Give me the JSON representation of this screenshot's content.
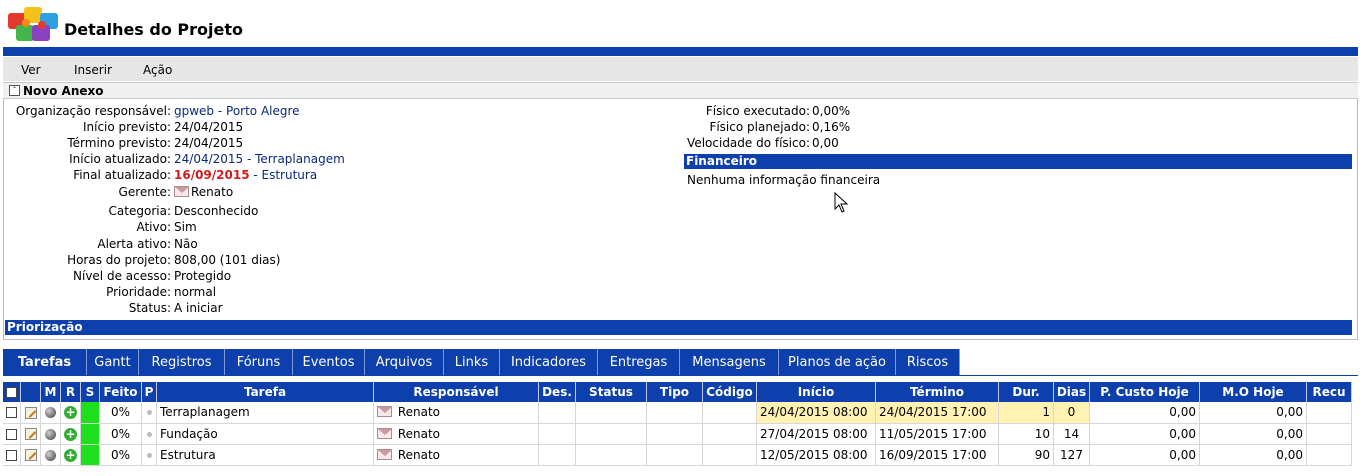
{
  "header": {
    "title": "Detalhes do Projeto"
  },
  "menu": {
    "items": [
      "Ver",
      "Inserir",
      "Ação"
    ]
  },
  "section": {
    "title": "Novo Anexo"
  },
  "details": {
    "organizacao_label": "Organização responsável:",
    "organizacao_value": "gpweb - Porto Alegre",
    "inicio_previsto_label": "Início previsto:",
    "inicio_previsto_value": "24/04/2015",
    "termino_previsto_label": "Término previsto:",
    "termino_previsto_value": "24/04/2015",
    "inicio_atualizado_label": "Início atualizado:",
    "inicio_atualizado_value": "24/04/2015 - Terraplanagem",
    "final_atualizado_label": "Final atualizado:",
    "final_atualizado_date": "16/09/2015",
    "final_atualizado_task": " - Estrutura",
    "gerente_label": "Gerente:",
    "gerente_value": "Renato",
    "categoria_label": "Categoria:",
    "categoria_value": "Desconhecido",
    "ativo_label": "Ativo:",
    "ativo_value": "Sim",
    "alerta_label": "Alerta ativo:",
    "alerta_value": "Não",
    "horas_label": "Horas do projeto:",
    "horas_value": "808,00 (101 dias)",
    "nivel_label": "Nível de acesso:",
    "nivel_value": "Protegido",
    "prioridade_label": "Prioridade:",
    "prioridade_value": "normal",
    "status_label": "Status:",
    "status_value": "A iniciar",
    "priorizacao_heading": "Priorização"
  },
  "right_details": {
    "fisico_exec_label": "Físico executado:",
    "fisico_exec_value": "0,00%",
    "fisico_plan_label": "Físico planejado:",
    "fisico_plan_value": "0,16%",
    "velocidade_label": "Velocidade do físico:",
    "velocidade_value": "0,00",
    "financeiro_heading": "Financeiro",
    "financeiro_empty": "Nenhuma informação financeira"
  },
  "tabs": [
    "Tarefas",
    "Gantt",
    "Registros",
    "Fóruns",
    "Eventos",
    "Arquivos",
    "Links",
    "Indicadores",
    "Entregas",
    "Mensagens",
    "Planos de ação",
    "Riscos"
  ],
  "table": {
    "columns": [
      "M",
      "R",
      "S",
      "Feito",
      "P",
      "Tarefa",
      "Responsável",
      "Des.",
      "Status",
      "Tipo",
      "Código",
      "Início",
      "Término",
      "Dur.",
      "Dias",
      "P. Custo Hoje",
      "M.O Hoje",
      "Recu"
    ],
    "rows": [
      {
        "feito": "0%",
        "tarefa": "Terraplanagem",
        "responsavel": "Renato",
        "inicio": "24/04/2015 08:00",
        "termino": "24/04/2015 17:00",
        "dur": "1",
        "dias": "0",
        "custo": "0,00",
        "mo": "0,00"
      },
      {
        "feito": "0%",
        "tarefa": "Fundação",
        "responsavel": "Renato",
        "inicio": "27/04/2015 08:00",
        "termino": "11/05/2015 17:00",
        "dur": "10",
        "dias": "14",
        "custo": "0,00",
        "mo": "0,00"
      },
      {
        "feito": "0%",
        "tarefa": "Estrutura",
        "responsavel": "Renato",
        "inicio": "12/05/2015 08:00",
        "termino": "16/09/2015 17:00",
        "dur": "90",
        "dias": "127",
        "custo": "0,00",
        "mo": "0,00"
      }
    ]
  },
  "colors": {
    "brand_blue": "#0d3fad",
    "highlight_yellow": "#fff2b3",
    "status_green": "#1be01b",
    "late_red": "#d21b1b"
  }
}
